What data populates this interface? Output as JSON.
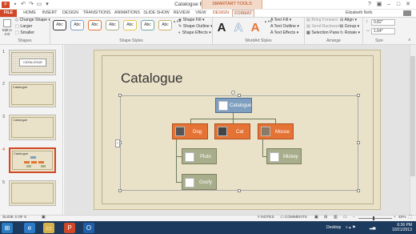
{
  "window": {
    "title": "Catalogue EAN - PowerPoint",
    "context_group": "SMARTART TOOLS",
    "user": "Elizabeth Nofs"
  },
  "tabs": [
    {
      "label": "FILE"
    },
    {
      "label": "HOME"
    },
    {
      "label": "INSERT"
    },
    {
      "label": "DESIGN"
    },
    {
      "label": "TRANSITIONS"
    },
    {
      "label": "ANIMATIONS"
    },
    {
      "label": "SLIDE SHOW"
    },
    {
      "label": "REVIEW"
    },
    {
      "label": "VIEW"
    },
    {
      "label": "DESIGN"
    },
    {
      "label": "FORMAT"
    }
  ],
  "ribbon": {
    "shapes": {
      "change_shape": "Change Shape",
      "larger": "Larger",
      "smaller": "Smaller",
      "edit_in_2d": "Edit in 2-D",
      "label": "Shapes"
    },
    "shape_styles": {
      "swatch": "Abc",
      "shape_fill": "Shape Fill",
      "shape_outline": "Shape Outline",
      "shape_effects": "Shape Effects",
      "label": "Shape Styles"
    },
    "wordart": {
      "text_fill": "Text Fill",
      "text_outline": "Text Outline",
      "text_effects": "Text Effects",
      "label": "WordArt Styles",
      "glyph": "A"
    },
    "arrange": {
      "bring_forward": "Bring Forward",
      "send_backward": "Send Backward",
      "selection_pane": "Selection Pane",
      "align": "Align",
      "group": "Group",
      "rotate": "Rotate",
      "label": "Arrange"
    },
    "size": {
      "height": "0.82\"",
      "width": "1.64\"",
      "label": "Size"
    }
  },
  "thumbnails": [
    {
      "num": "1",
      "title": "CATALOGUE"
    },
    {
      "num": "2",
      "title": "Catalogue"
    },
    {
      "num": "3",
      "title": "Catalogue"
    },
    {
      "num": "4",
      "title": "Catalogue"
    },
    {
      "num": "5",
      "title": ""
    }
  ],
  "slide": {
    "title": "Catalogue",
    "nodes": {
      "top": "Catalogue",
      "dog": "Dog",
      "cat": "Cat",
      "mouse": "Mouse",
      "pluto": "Pluto",
      "goofy": "Goofy",
      "mickey": "Mickey"
    }
  },
  "status": {
    "slide_of": "SLIDE 4 OF 5",
    "notes": "NOTES",
    "comments": "COMMENTS",
    "zoom": "40%"
  },
  "taskbar": {
    "desktop": "Desktop",
    "time": "6:36 PM",
    "date": "10/21/2013"
  },
  "colors": {
    "accent": "#d24726",
    "node_top": "#7f9fc1",
    "node_mid": "#e57335",
    "node_low": "#a8ae8c",
    "slide_bg": "#eae2c8"
  }
}
